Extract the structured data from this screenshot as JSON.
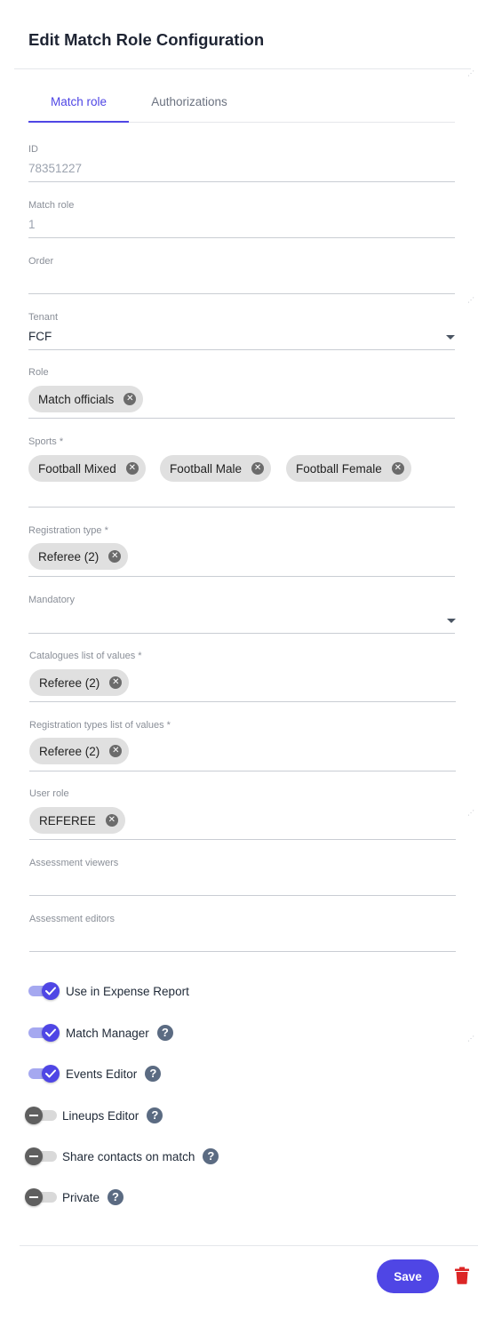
{
  "title": "Edit Match Role Configuration",
  "tabs": [
    {
      "label": "Match role",
      "active": true
    },
    {
      "label": "Authorizations",
      "active": false
    }
  ],
  "fields": {
    "id": {
      "label": "ID",
      "value": "78351227"
    },
    "match_role": {
      "label": "Match role",
      "value": "1"
    },
    "order": {
      "label": "Order",
      "value": ""
    },
    "tenant": {
      "label": "Tenant",
      "value": "FCF"
    },
    "role": {
      "label": "Role",
      "chips": [
        "Match officials"
      ]
    },
    "sports": {
      "label": "Sports *",
      "chips": [
        "Football Mixed",
        "Football Male",
        "Football Female"
      ]
    },
    "registration_type": {
      "label": "Registration type *",
      "chips": [
        "Referee (2)"
      ]
    },
    "mandatory": {
      "label": "Mandatory",
      "value": ""
    },
    "catalogues": {
      "label": "Catalogues list of values *",
      "chips": [
        "Referee (2)"
      ]
    },
    "registration_types_list": {
      "label": "Registration types list of values *",
      "chips": [
        "Referee (2)"
      ]
    },
    "user_role": {
      "label": "User role",
      "chips": [
        "REFEREE"
      ]
    },
    "assessment_viewers": {
      "label": "Assessment viewers",
      "value": ""
    },
    "assessment_editors": {
      "label": "Assessment editors",
      "value": ""
    }
  },
  "toggles": [
    {
      "label": "Use in Expense Report",
      "on": true,
      "help": false
    },
    {
      "label": "Match Manager",
      "on": true,
      "help": true
    },
    {
      "label": "Events Editor",
      "on": true,
      "help": true
    },
    {
      "label": "Lineups Editor",
      "on": false,
      "help": true
    },
    {
      "label": "Share contacts on match",
      "on": false,
      "help": true
    },
    {
      "label": "Private",
      "on": false,
      "help": true
    }
  ],
  "footer": {
    "save_label": "Save"
  },
  "icons": {
    "chip_remove": "close-circle-icon",
    "help": "help-circle-icon",
    "delete": "trash-icon",
    "dropdown": "caret-down-icon"
  },
  "colors": {
    "accent": "#4f46e5",
    "danger": "#dc2626",
    "help_icon": "#5b6b82",
    "chip_bg": "#e0e0e0"
  }
}
